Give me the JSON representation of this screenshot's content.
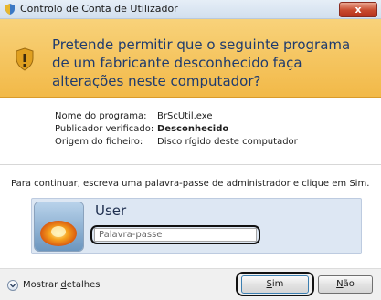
{
  "window": {
    "title": "Controlo de Conta de Utilizador",
    "close_label": "x"
  },
  "banner": {
    "question": "Pretende permitir que o seguinte programa de um fabricante desconhecido faça alterações neste computador?",
    "icon": "uac-shield-warning-icon"
  },
  "details": [
    {
      "label": "Nome do programa:",
      "value": "BrScUtil.exe"
    },
    {
      "label": "Publicador verificado:",
      "value": "Desconhecido"
    },
    {
      "label": "Origem do ficheiro:",
      "value": "Disco rígido deste computador"
    }
  ],
  "instruction": "Para continuar, escreva uma palavra-passe de administrador e clique em Sim.",
  "credentials": {
    "username": "User",
    "password_placeholder": "Palavra-passe",
    "password_value": ""
  },
  "footer": {
    "details_toggle": {
      "prefix": "Mostrar ",
      "accel": "d",
      "rest": "etalhes"
    },
    "yes_button": {
      "accel": "S",
      "rest": "im"
    },
    "no_button": {
      "accel": "N",
      "rest": "ão"
    }
  },
  "colors": {
    "banner": "#f4c255",
    "question_text": "#1f3b6e",
    "titlebar": "#dbe6f2",
    "close_button": "#c8492d"
  }
}
